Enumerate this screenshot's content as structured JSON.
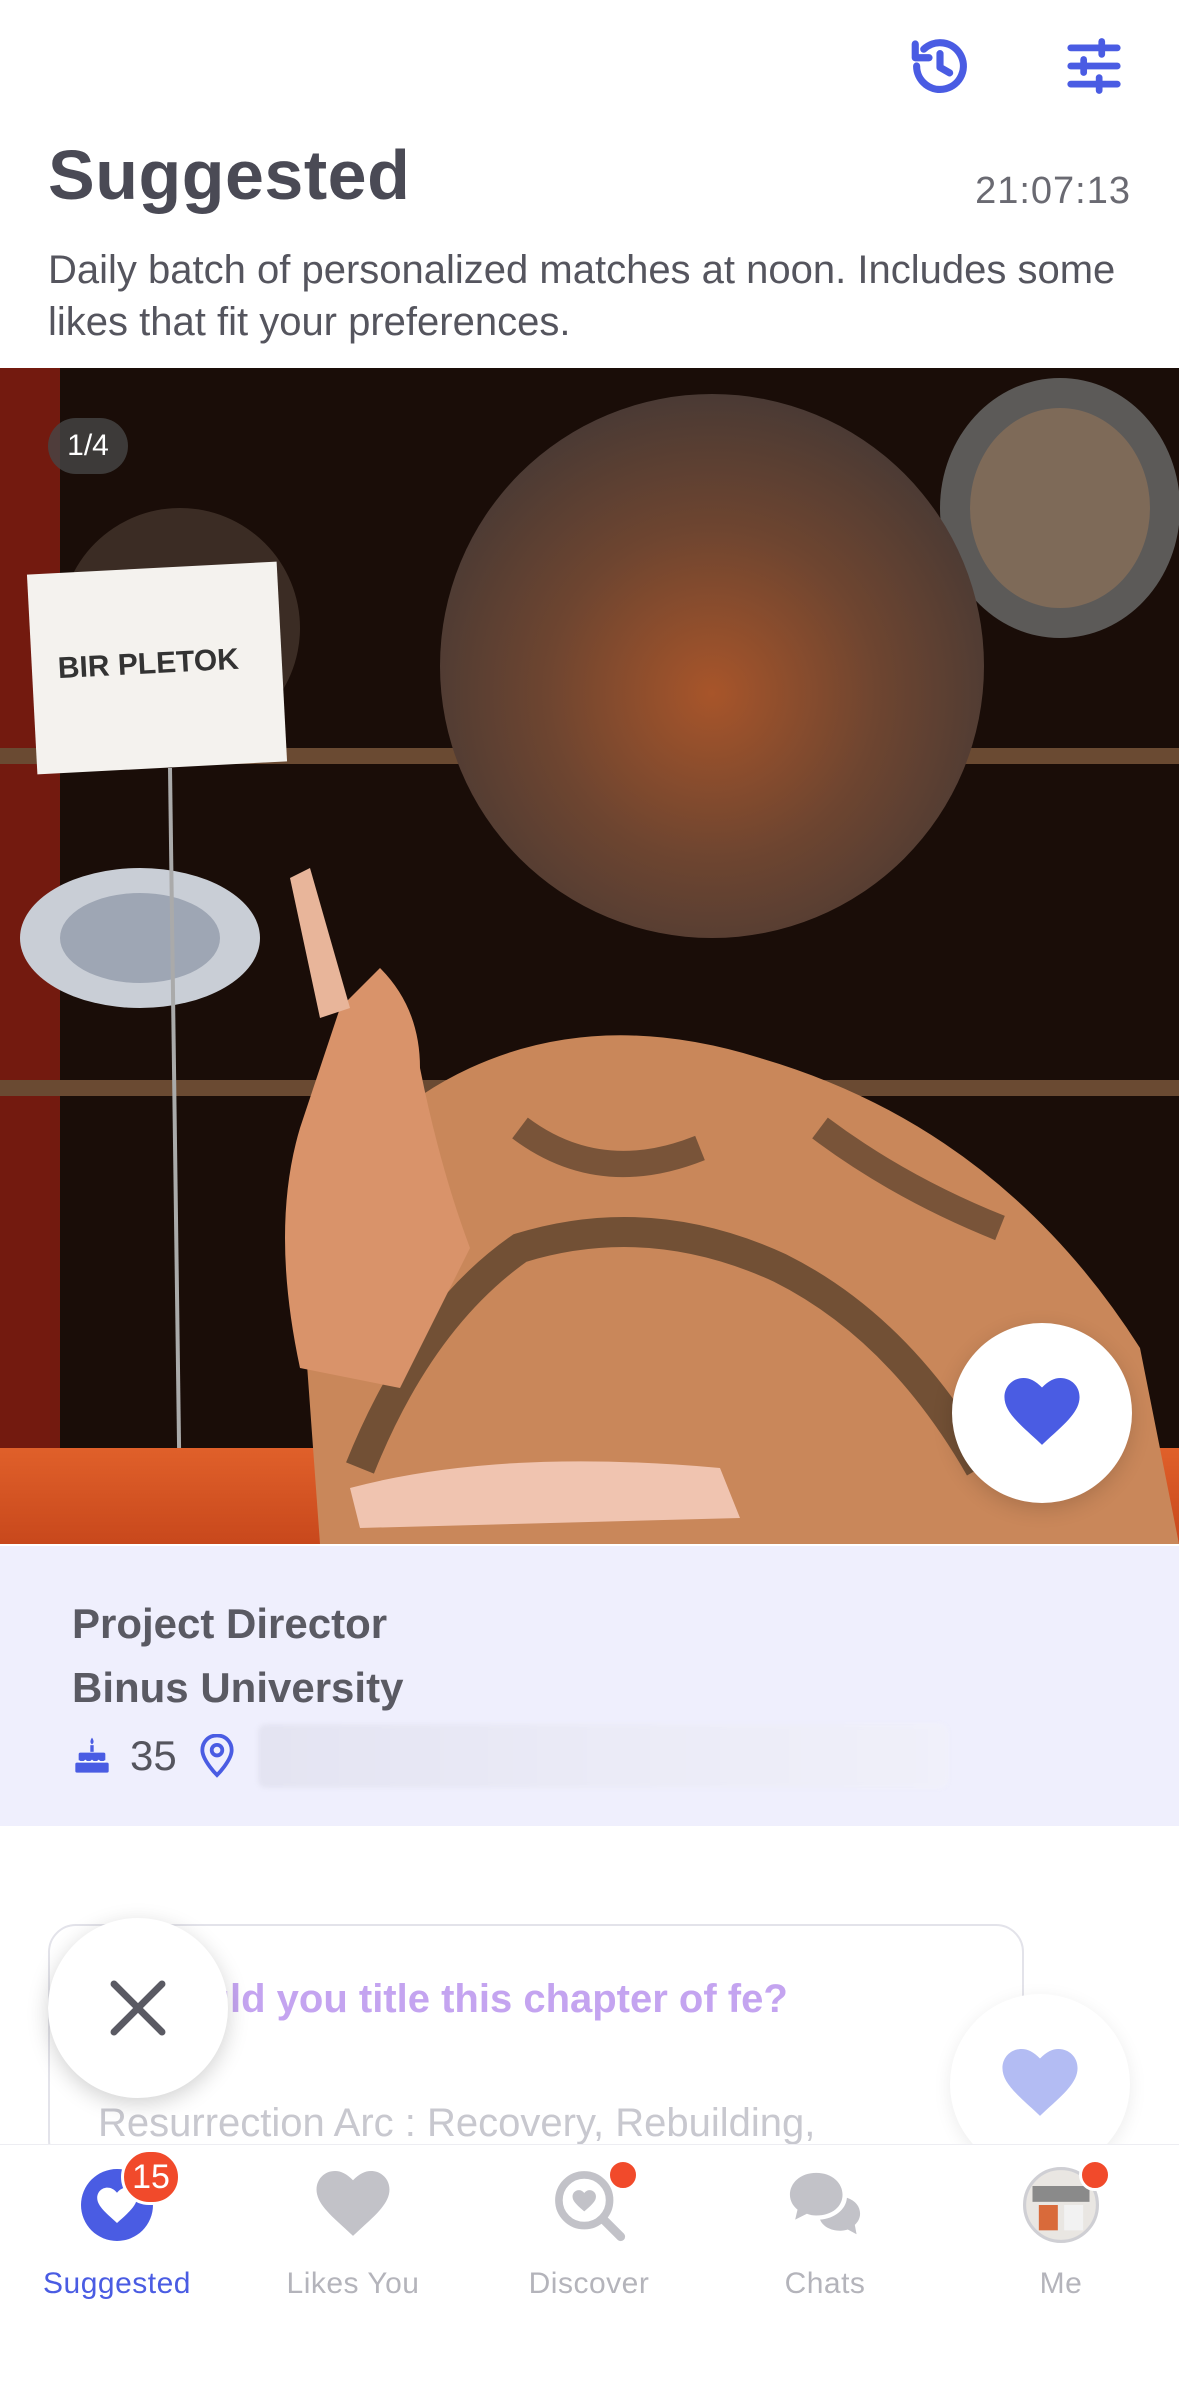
{
  "header": {
    "title": "Suggested",
    "timer": "21:07:13",
    "description": "Daily batch of personalized matches at noon. Includes some likes that fit your preferences."
  },
  "photo": {
    "counter": "1/4",
    "sign_text": "BIR PLETOK"
  },
  "profile": {
    "job": "Project Director",
    "school": "Binus University",
    "age": "35"
  },
  "prompt": {
    "question_visible": "would you title this chapter of fe?",
    "answer_preview": "Resurrection Arc : Recovery, Rebuilding,"
  },
  "tabs": [
    {
      "label": "Suggested",
      "badge": "15",
      "active": true
    },
    {
      "label": "Likes You"
    },
    {
      "label": "Discover",
      "dot": true
    },
    {
      "label": "Chats"
    },
    {
      "label": "Me",
      "dot": true
    }
  ],
  "colors": {
    "accent": "#4a5ce3",
    "badge": "#f14a2b",
    "info_bg": "#efeffd",
    "prompt_text": "#c4a4f0"
  },
  "icons": [
    "history-icon",
    "filter-sliders-icon",
    "heart-icon",
    "close-icon",
    "cake-icon",
    "location-pin-icon",
    "search-heart-icon",
    "chat-bubbles-icon",
    "avatar"
  ]
}
